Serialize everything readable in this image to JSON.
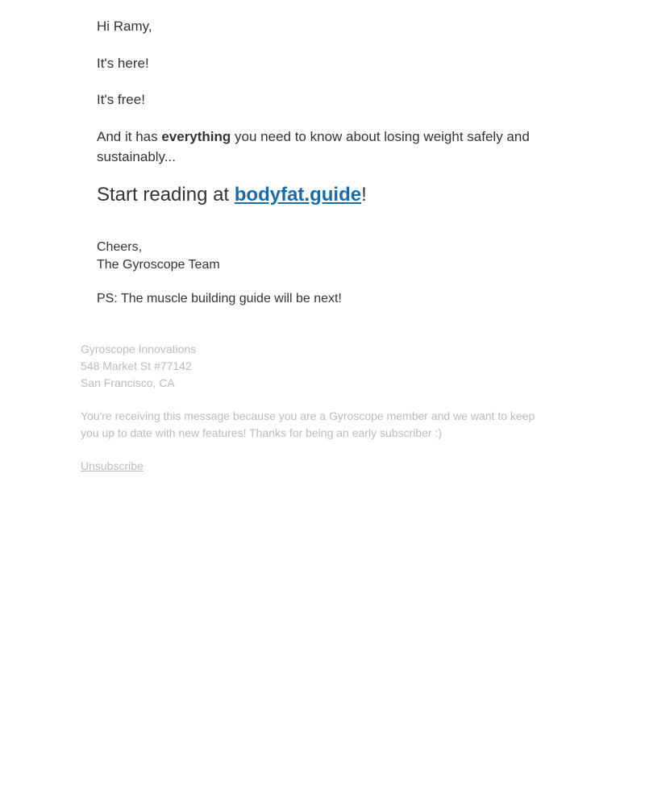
{
  "email": {
    "greeting": "Hi Ramy,",
    "line1": "It's here!",
    "line2": "It's free!",
    "line3_prefix": "And it has ",
    "line3_bold": "everything",
    "line3_suffix": " you need to know about losing weight safely and sustainably...",
    "cta_prefix": "Start reading at ",
    "cta_link_text": "bodyfat.guide",
    "cta_suffix": "!",
    "signoff_line1": "Cheers,",
    "signoff_line2": "The Gyroscope Team",
    "ps": "PS: The muscle building guide will be next!"
  },
  "footer": {
    "company": "Gyroscope Innovations",
    "address_line1": "548 Market St #77142",
    "address_line2": "San Francisco, CA",
    "info": "You're receiving this message because you are a Gyroscope member and we want to keep you up to date with new features! Thanks for being an early subscriber :)",
    "unsubscribe": "Unsubscribe"
  }
}
